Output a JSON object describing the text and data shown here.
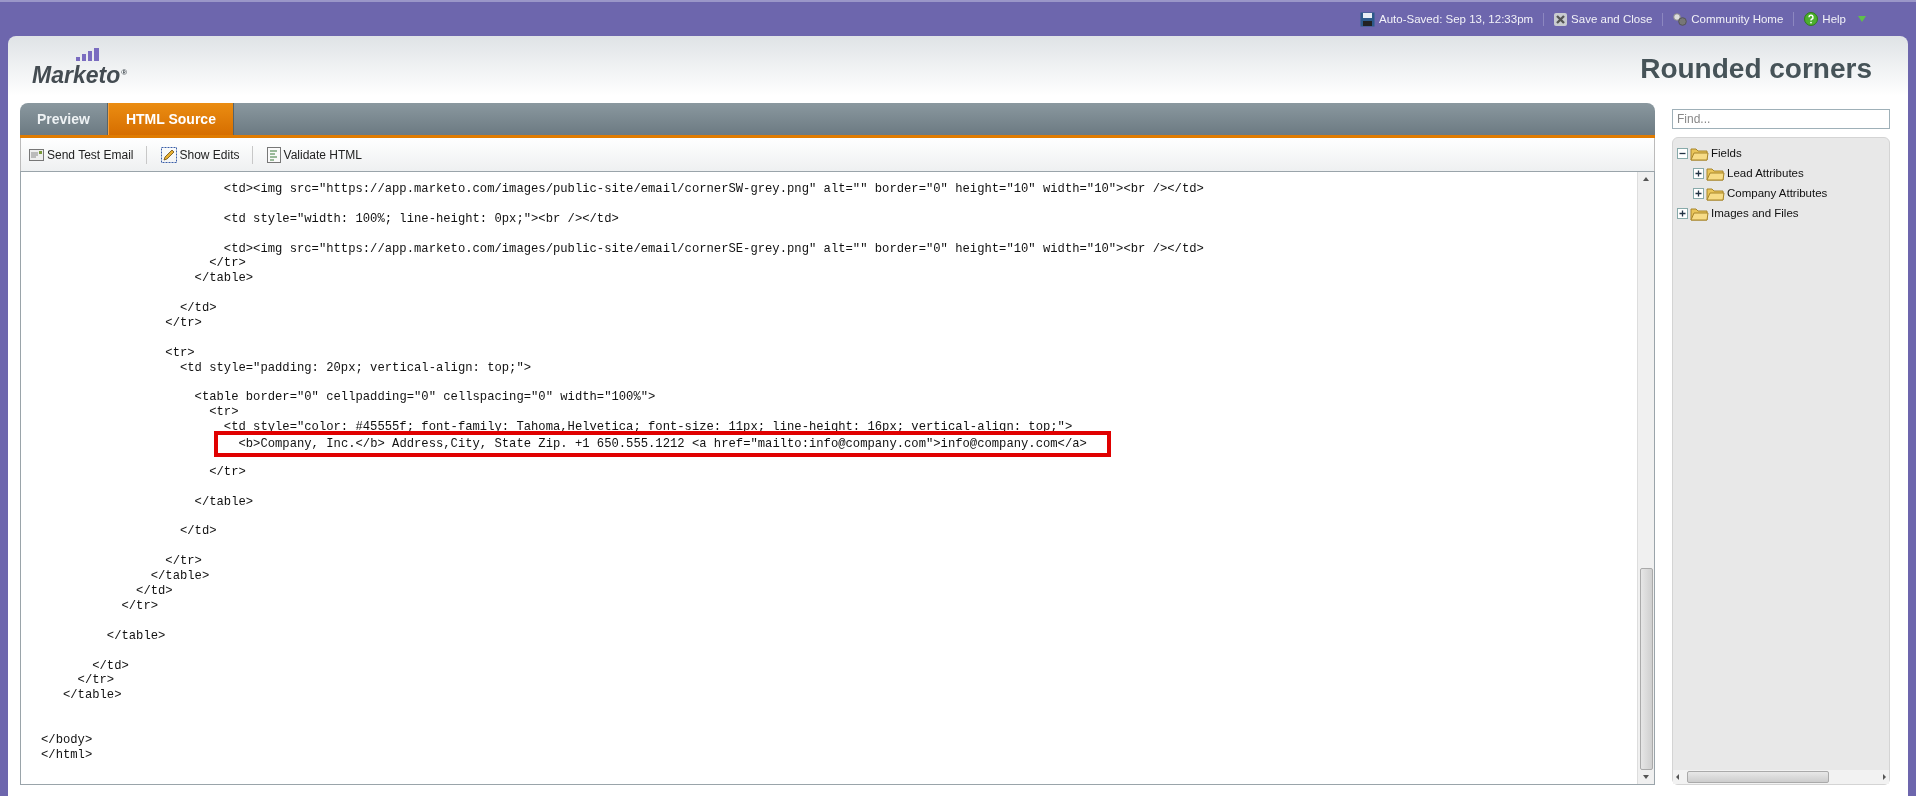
{
  "top_bar": {
    "autosave": "Auto-Saved: Sep 13, 12:33pm",
    "actions": [
      {
        "kind": "save-close",
        "label": "Save and Close"
      },
      {
        "kind": "community",
        "label": "Community Home"
      },
      {
        "kind": "help",
        "label": "Help"
      }
    ]
  },
  "logo": {
    "text": "Marketo",
    "mark": "®"
  },
  "title": "Rounded corners",
  "tabs": [
    {
      "label": "Preview",
      "selected": false
    },
    {
      "label": "HTML Source",
      "selected": true
    }
  ],
  "toolbar": [
    {
      "kind": "email",
      "label": "Send Test Email"
    },
    {
      "kind": "edits",
      "label": "Show Edits"
    },
    {
      "kind": "validate",
      "label": "Validate HTML"
    }
  ],
  "code_lines": [
    {
      "kind": "code",
      "text": "                         <td><img src=\"https://app.marketo.com/images/public-site/email/cornerSW-grey.png\" alt=\"\" border=\"0\" height=\"10\" width=\"10\"><br /></td>",
      "highlighted": false
    },
    {
      "kind": "blank"
    },
    {
      "kind": "code",
      "text": "                         <td style=\"width: 100%; line-height: 0px;\"><br /></td>",
      "highlighted": false
    },
    {
      "kind": "blank"
    },
    {
      "kind": "code",
      "text": "                         <td><img src=\"https://app.marketo.com/images/public-site/email/cornerSE-grey.png\" alt=\"\" border=\"0\" height=\"10\" width=\"10\"><br /></td>",
      "highlighted": false
    },
    {
      "kind": "code",
      "text": "                       </tr>",
      "highlighted": false
    },
    {
      "kind": "code",
      "text": "                     </table>",
      "highlighted": false
    },
    {
      "kind": "blank"
    },
    {
      "kind": "code",
      "text": "                   </td>",
      "highlighted": false
    },
    {
      "kind": "code",
      "text": "                 </tr>",
      "highlighted": false
    },
    {
      "kind": "blank"
    },
    {
      "kind": "code",
      "text": "                 <tr>",
      "highlighted": false
    },
    {
      "kind": "code",
      "text": "                   <td style=\"padding: 20px; vertical-align: top;\">",
      "highlighted": false
    },
    {
      "kind": "blank"
    },
    {
      "kind": "code",
      "text": "                     <table border=\"0\" cellpadding=\"0\" cellspacing=\"0\" width=\"100%\">",
      "highlighted": false
    },
    {
      "kind": "code",
      "text": "                       <tr>",
      "highlighted": false
    },
    {
      "kind": "code",
      "text": "                         <td style=\"color: #45555f; font-family: Tahoma,Helvetica; font-size: 11px; line-height: 16px; vertical-align: top;\">",
      "highlighted": false
    },
    {
      "kind": "code",
      "text": "                           <b>Company, Inc.</b> Address,City, State Zip. +1 650.555.1212 <a href=\"mailto:info@company.com\">info@company.com</a>",
      "highlighted": true
    },
    {
      "kind": "blank"
    },
    {
      "kind": "code",
      "text": "                       </tr>",
      "highlighted": false
    },
    {
      "kind": "blank"
    },
    {
      "kind": "code",
      "text": "                     </table>",
      "highlighted": false
    },
    {
      "kind": "blank"
    },
    {
      "kind": "code",
      "text": "                   </td>",
      "highlighted": false
    },
    {
      "kind": "blank"
    },
    {
      "kind": "code",
      "text": "                 </tr>",
      "highlighted": false
    },
    {
      "kind": "code",
      "text": "               </table>",
      "highlighted": false
    },
    {
      "kind": "code",
      "text": "             </td>",
      "highlighted": false
    },
    {
      "kind": "code",
      "text": "           </tr>",
      "highlighted": false
    },
    {
      "kind": "blank"
    },
    {
      "kind": "code",
      "text": "         </table>",
      "highlighted": false
    },
    {
      "kind": "blank"
    },
    {
      "kind": "code",
      "text": "       </td>",
      "highlighted": false
    },
    {
      "kind": "code",
      "text": "     </tr>",
      "highlighted": false
    },
    {
      "kind": "code",
      "text": "   </table>",
      "highlighted": false
    },
    {
      "kind": "blank"
    },
    {
      "kind": "blank"
    },
    {
      "kind": "code",
      "text": "</body>",
      "highlighted": false
    },
    {
      "kind": "code",
      "text": "</html>",
      "highlighted": false
    }
  ],
  "find": {
    "placeholder": "Find..."
  },
  "tree": [
    {
      "label": "Fields",
      "expanded": true,
      "children": [
        {
          "label": "Lead Attributes",
          "expanded": false
        },
        {
          "label": "Company Attributes",
          "expanded": false
        }
      ]
    },
    {
      "label": "Images and Files",
      "expanded": false
    }
  ]
}
